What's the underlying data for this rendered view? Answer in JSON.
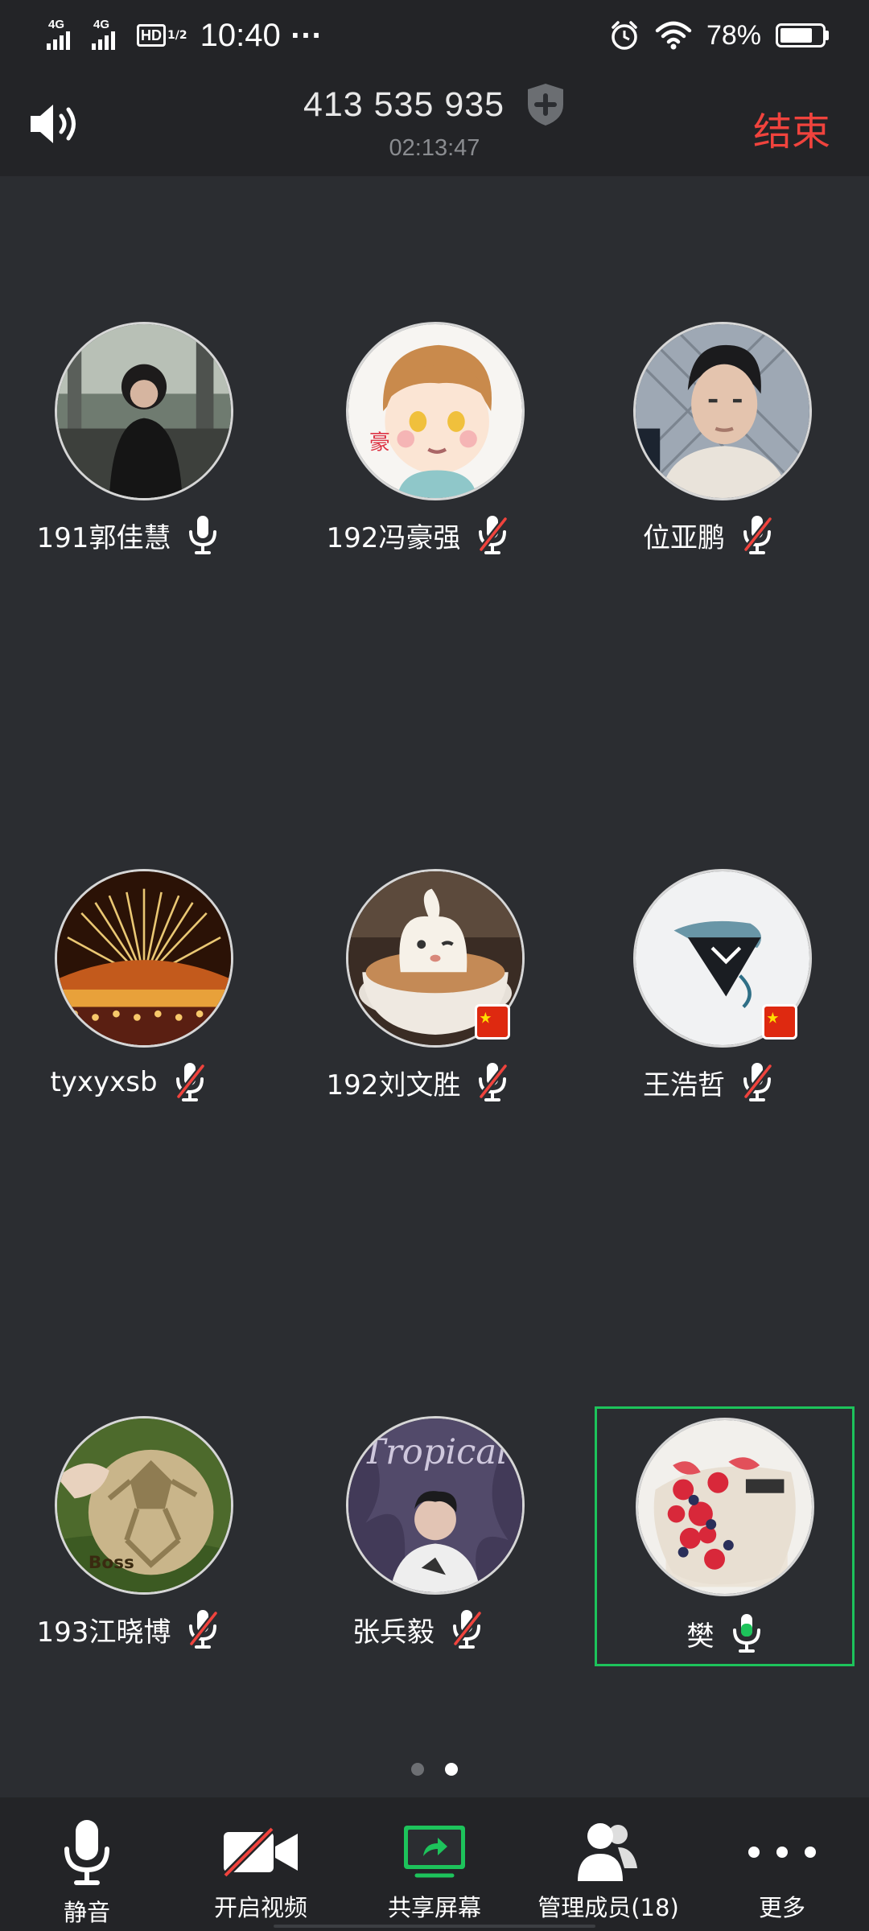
{
  "status_bar": {
    "network_1": "4G",
    "network_2": "4G",
    "hd_label": "HD",
    "hd_fraction": "1/2",
    "time": "10:40",
    "more_dots": "···",
    "battery_percent": "78%",
    "battery_level": 0.78
  },
  "call_header": {
    "meeting_id": "413 535 935",
    "duration": "02:13:47",
    "end_label": "结束",
    "end_color": "#f0433d"
  },
  "participants": [
    {
      "name": "191郭佳慧",
      "mic": "on",
      "avatar": "photo-girl"
    },
    {
      "name": "192冯豪强",
      "mic": "muted",
      "avatar": "cartoon-boy"
    },
    {
      "name": "位亚鹏",
      "mic": "muted",
      "avatar": "photo-boy"
    },
    {
      "name": "tyxyxsb",
      "mic": "muted",
      "avatar": "fireworks"
    },
    {
      "name": "192刘文胜",
      "mic": "muted",
      "avatar": "latte-art",
      "flag": true
    },
    {
      "name": "王浩哲",
      "mic": "muted",
      "avatar": "triangle-logo",
      "flag": true
    },
    {
      "name": "193江晓博",
      "mic": "muted",
      "avatar": "football"
    },
    {
      "name": "张兵毅",
      "mic": "muted",
      "avatar": "tropical-photo"
    },
    {
      "name": "樊",
      "mic": "speaking",
      "avatar": "fruit-cake",
      "active": true
    }
  ],
  "pager": {
    "pages": 2,
    "current": 2
  },
  "toolbar": {
    "mute": "静音",
    "video": "开启视频",
    "share": "共享屏幕",
    "manage": "管理成员(18)",
    "more": "更多"
  },
  "colors": {
    "background": "#2b2d31",
    "bar": "#232427",
    "active_border": "#1dc35b",
    "muted_slash": "#f0433d",
    "share_green": "#1dc35b"
  }
}
